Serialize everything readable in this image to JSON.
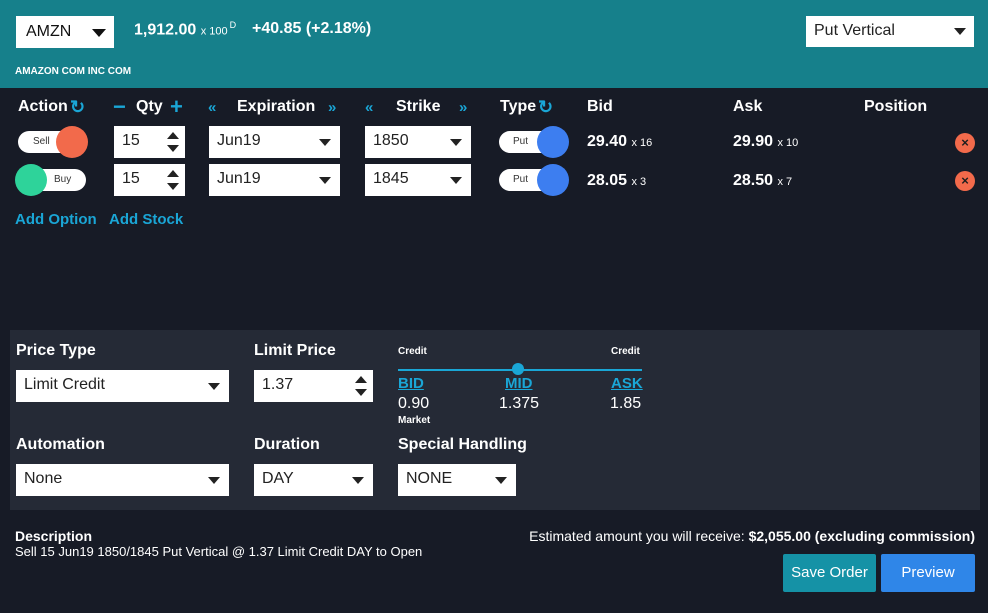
{
  "header": {
    "symbol": "AMZN",
    "price": "1,912.00",
    "multiplier": "x 100",
    "price_sup": "D",
    "change": "+40.85 (+2.18%)",
    "company": "AMAZON COM INC COM",
    "strategy": "Put Vertical"
  },
  "columns": {
    "action": "Action",
    "qty": "Qty",
    "expiration": "Expiration",
    "strike": "Strike",
    "type": "Type",
    "bid": "Bid",
    "ask": "Ask",
    "position": "Position"
  },
  "legs": [
    {
      "action": "Sell",
      "qty": "15",
      "expiration": "Jun19",
      "strike": "1850",
      "type": "Put",
      "bid": "29.40",
      "bid_size": "x 16",
      "ask": "29.90",
      "ask_size": "x 10"
    },
    {
      "action": "Buy",
      "qty": "15",
      "expiration": "Jun19",
      "strike": "1845",
      "type": "Put",
      "bid": "28.05",
      "bid_size": "x 3",
      "ask": "28.50",
      "ask_size": "x 7"
    }
  ],
  "links": {
    "add_option": "Add Option",
    "add_stock": "Add Stock"
  },
  "order": {
    "price_type_label": "Price Type",
    "price_type": "Limit Credit",
    "limit_price_label": "Limit Price",
    "limit_price": "1.37",
    "credit_left": "Credit",
    "credit_right": "Credit",
    "bid_label": "BID",
    "bid_value": "0.90",
    "market_label": "Market",
    "mid_label": "MID",
    "mid_value": "1.375",
    "ask_label": "ASK",
    "ask_value": "1.85",
    "automation_label": "Automation",
    "automation": "None",
    "duration_label": "Duration",
    "duration": "DAY",
    "special_label": "Special Handling",
    "special": "NONE"
  },
  "footer": {
    "description_label": "Description",
    "description": "Sell 15 Jun19 1850/1845 Put Vertical @ 1.37 Limit Credit DAY to Open",
    "estimate_text": "Estimated amount you will receive:",
    "estimate_value": "$2,055.00 (excluding commission)",
    "save_order": "Save Order",
    "preview": "Preview"
  },
  "colors": {
    "header_bg": "#16808b",
    "accent": "#1aa6d6",
    "sell_knob": "#f26a4b",
    "buy_knob": "#2ed39a",
    "put_knob": "#3d7ef0",
    "save_btn": "#1592a6",
    "preview_btn": "#2f86e8"
  }
}
